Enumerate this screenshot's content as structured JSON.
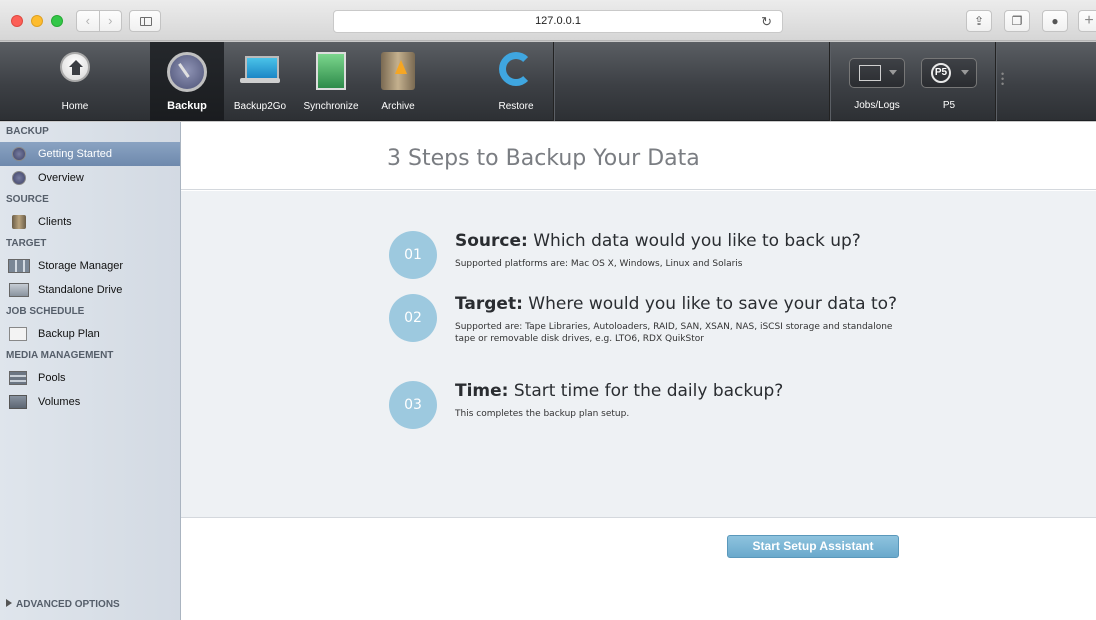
{
  "browser": {
    "url": "127.0.0.1"
  },
  "toolbar": {
    "items": [
      {
        "label": "Home",
        "icon": "home-icon"
      },
      {
        "label": "Backup",
        "icon": "gauge-icon",
        "active": true
      },
      {
        "label": "Backup2Go",
        "icon": "laptop-icon"
      },
      {
        "label": "Synchronize",
        "icon": "sync-icon"
      },
      {
        "label": "Archive",
        "icon": "archive-icon"
      },
      {
        "label": "Restore",
        "icon": "restore-icon"
      }
    ],
    "right": [
      {
        "label": "Jobs/Logs",
        "icon": "monitor-icon"
      },
      {
        "label": "P5",
        "icon": "p5-logo-icon",
        "logo_text": "P5"
      }
    ]
  },
  "sidebar": {
    "sections": [
      {
        "title": "BACKUP",
        "items": [
          "Getting Started",
          "Overview"
        ]
      },
      {
        "title": "SOURCE",
        "items": [
          "Clients"
        ]
      },
      {
        "title": "TARGET",
        "items": [
          "Storage Manager",
          "Standalone Drive"
        ]
      },
      {
        "title": "JOB SCHEDULE",
        "items": [
          "Backup Plan"
        ]
      },
      {
        "title": "MEDIA MANAGEMENT",
        "items": [
          "Pools",
          "Volumes"
        ]
      }
    ],
    "selected": "Getting Started",
    "advanced": "ADVANCED OPTIONS"
  },
  "main": {
    "title": "3 Steps to Backup Your Data",
    "steps": [
      {
        "num": "01",
        "key": "Source:",
        "question": "Which data would you like to back up?",
        "desc": "Supported platforms are: Mac OS X, Windows, Linux and Solaris"
      },
      {
        "num": "02",
        "key": "Target:",
        "question": "Where would you like to save your data to?",
        "desc": "Supported are: Tape Libraries, Autoloaders, RAID, SAN, XSAN, NAS, iSCSI storage and standalone tape or removable disk drives, e.g. LTO6, RDX QuikStor"
      },
      {
        "num": "03",
        "key": "Time:",
        "question": "Start time for the daily backup?",
        "desc": "This completes the backup plan setup."
      }
    ],
    "button": "Start Setup Assistant"
  },
  "colors": {
    "accent": "#9dc9df",
    "button": "#6aa9cc",
    "selected": "#7690b3"
  }
}
